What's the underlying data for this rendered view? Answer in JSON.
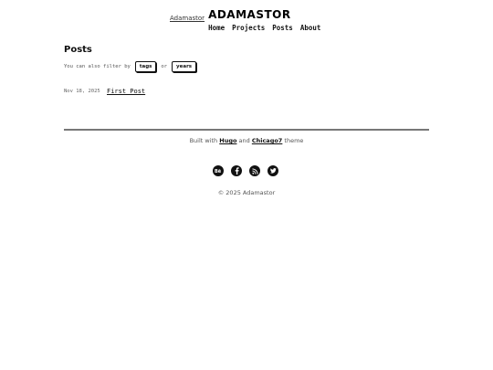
{
  "header": {
    "logo_alt": "Adamastor",
    "site_title": "ADAMASTOR",
    "nav": [
      {
        "label": "Home"
      },
      {
        "label": "Projects"
      },
      {
        "label": "Posts"
      },
      {
        "label": "About"
      }
    ]
  },
  "main": {
    "title": "Posts",
    "filter_prefix": "You can also filter by",
    "filter_tags": "tags",
    "filter_or": "or",
    "filter_years": "years",
    "posts": [
      {
        "date": "Nov 18, 2025",
        "title": "First Post"
      }
    ]
  },
  "footer": {
    "built_with": "Built with",
    "hugo": "Hugo",
    "and": "and",
    "theme_name": "Chicago7",
    "theme_word": "theme",
    "social": [
      {
        "icon": "behance-icon",
        "glyph": "Bē"
      },
      {
        "icon": "facebook-icon",
        "glyph": "f"
      },
      {
        "icon": "rss-icon",
        "glyph": "rss"
      },
      {
        "icon": "twitter-icon",
        "glyph": "bird"
      }
    ],
    "copyright": "© 2025 Adamastor"
  },
  "colors": {
    "text": "#111111",
    "muted": "#555555",
    "divider": "#777777",
    "background": "#ffffff"
  }
}
